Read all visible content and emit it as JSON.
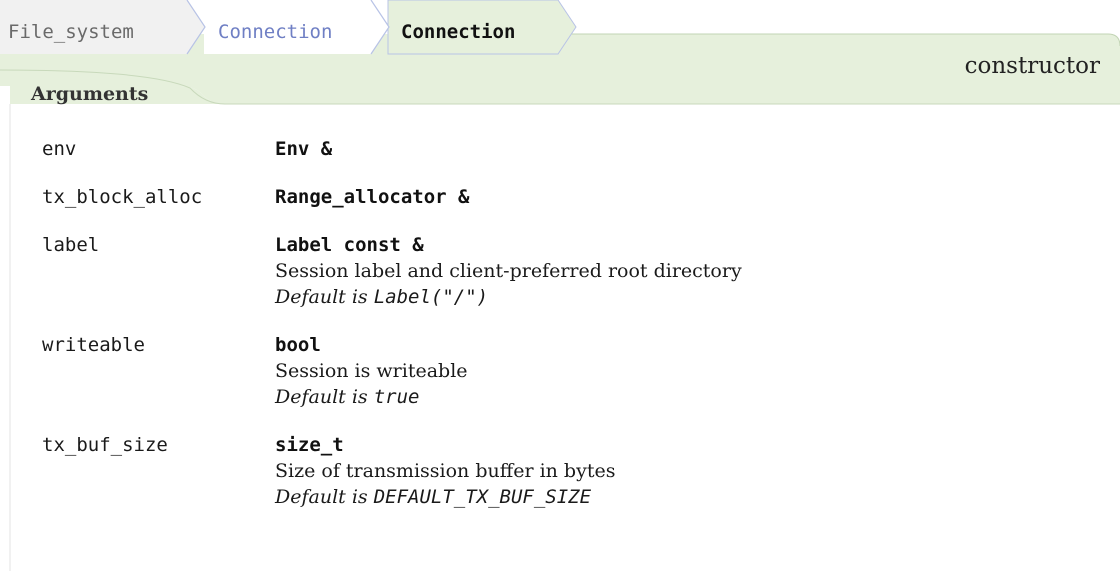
{
  "breadcrumb": {
    "items": [
      {
        "label": "File_system"
      },
      {
        "label": "Connection"
      },
      {
        "label": "Connection"
      }
    ]
  },
  "header": {
    "kind": "constructor",
    "section_label": "Arguments"
  },
  "colors": {
    "band": "#e6f0dc",
    "band_border": "#c2d4b4",
    "crumb_root": "#f1f1f1",
    "crumb_mid": "#ffffff",
    "crumb_link": "#6f7fc4",
    "crumb_arrow": "#b8c3e6"
  },
  "arguments": [
    {
      "name": "env",
      "type": "Env &"
    },
    {
      "name": "tx_block_alloc",
      "type": "Range_allocator &"
    },
    {
      "name": "label",
      "type": "Label const &",
      "description": "Session label and client-preferred root directory",
      "default_prefix": "Default is",
      "default_value": "Label(\"/\")"
    },
    {
      "name": "writeable",
      "type": "bool",
      "description": "Session is writeable",
      "default_prefix": "Default is",
      "default_value": "true"
    },
    {
      "name": "tx_buf_size",
      "type": "size_t",
      "description": "Size of transmission buffer in bytes",
      "default_prefix": "Default is",
      "default_value": "DEFAULT_TX_BUF_SIZE"
    }
  ]
}
